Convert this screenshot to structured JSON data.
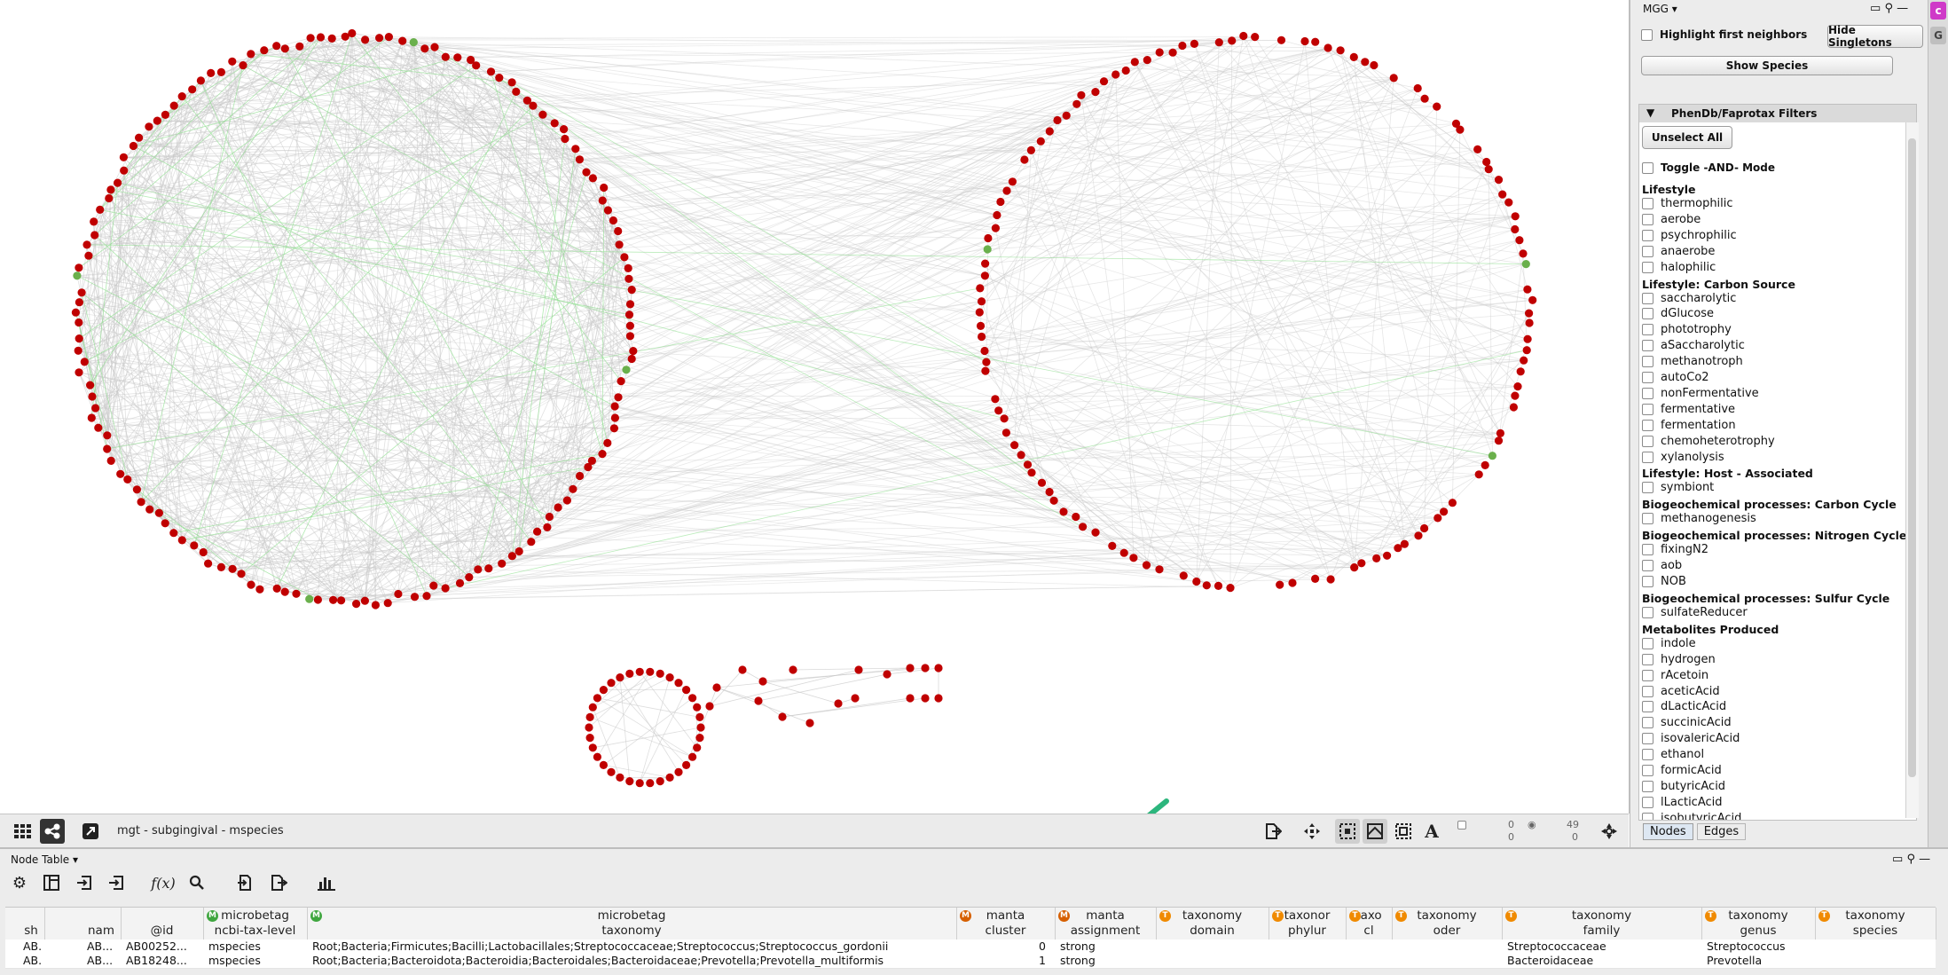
{
  "network": {
    "title": "mgt - subgingival - mspecies",
    "selection_counts": {
      "nodes_selected": "0",
      "edges_selected": "0",
      "nodes_visible": "49",
      "edges_visible": "0"
    }
  },
  "side_panel": {
    "dropdown_label": "MGG",
    "highlight_label": "Highlight first neighbors",
    "hide_singletons_label": "Hide Singletons",
    "show_species_label": "Show Species",
    "filters_title": "PhenDb/Faprotax Filters",
    "unselect_all_label": "Unselect All",
    "toggle_and_label": "Toggle -AND- Mode",
    "groups": [
      {
        "title": "Lifestyle",
        "items": [
          "thermophilic",
          "aerobe",
          "psychrophilic",
          "anaerobe",
          "halophilic"
        ]
      },
      {
        "title": "Lifestyle: Carbon Source",
        "items": [
          "saccharolytic",
          "dGlucose",
          "phototrophy",
          "aSaccharolytic",
          "methanotroph",
          "autoCo2",
          "nonFermentative",
          "fermentative",
          "fermentation",
          "chemoheterotrophy",
          "xylanolysis"
        ]
      },
      {
        "title": "Lifestyle: Host - Associated",
        "items": [
          "symbiont"
        ]
      },
      {
        "title": "Biogeochemical processes: Carbon Cycle",
        "items": [
          "methanogenesis"
        ]
      },
      {
        "title": "Biogeochemical processes: Nitrogen Cycle",
        "items": [
          "fixingN2",
          "aob",
          "NOB"
        ]
      },
      {
        "title": "Biogeochemical processes: Sulfur Cycle",
        "items": [
          "sulfateReducer"
        ]
      },
      {
        "title": "Metabolites Produced",
        "items": [
          "indole",
          "hydrogen",
          "rAcetoin",
          "aceticAcid",
          "dLacticAcid",
          "succinicAcid",
          "isovalericAcid",
          "ethanol",
          "formicAcid",
          "butyricAcid",
          "lLacticAcid",
          "isobutyricAcid"
        ]
      }
    ],
    "tabs": [
      "Nodes",
      "Edges"
    ],
    "strip_chips": [
      "c",
      "G"
    ]
  },
  "table_panel": {
    "title": "Node Table",
    "columns": [
      {
        "line1": "",
        "line2": "sh"
      },
      {
        "line1": "",
        "line2": "nam"
      },
      {
        "line1": "",
        "line2": "@id"
      },
      {
        "line1": "microbetag",
        "line2": "ncbi-tax-level",
        "badge": "M"
      },
      {
        "line1": "microbetag",
        "line2": "taxonomy",
        "badge": "M"
      },
      {
        "line1": "manta",
        "line2": "cluster",
        "badge": "M"
      },
      {
        "line1": "manta",
        "line2": "assignment",
        "badge": "M"
      },
      {
        "line1": "taxonomy",
        "line2": "domain",
        "badge": "T"
      },
      {
        "line1": "taxonor",
        "line2": "phylur",
        "badge": "T"
      },
      {
        "line1": "taxo",
        "line2": "cl",
        "badge": "T"
      },
      {
        "line1": "taxonomy",
        "line2": "oder",
        "badge": "T"
      },
      {
        "line1": "taxonomy",
        "line2": "family",
        "badge": "T"
      },
      {
        "line1": "taxonomy",
        "line2": "genus",
        "badge": "T"
      },
      {
        "line1": "taxonomy",
        "line2": "species",
        "badge": "T"
      }
    ],
    "rows": [
      {
        "sh": "AB...",
        "nam": "AB...",
        "id": "AB00252...",
        "level": "mspecies",
        "taxonomy": "Root;Bacteria;Firmicutes;Bacilli;Lactobacillales;Streptococcaceae;Streptococcus;Streptococcus_gordonii",
        "cluster": "0",
        "assignment": "strong",
        "family": "Streptococcaceae",
        "genus": "Streptococcus"
      },
      {
        "sh": "AB...",
        "nam": "AB...",
        "id": "AB18248...",
        "level": "mspecies",
        "taxonomy": "Root;Bacteria;Bacteroidota;Bacteroidia;Bacteroidales;Bacteroidaceae;Prevotella;Prevotella_multiformis",
        "cluster": "1",
        "assignment": "strong",
        "family": "Bacteroidaceae",
        "genus": "Prevotella"
      }
    ]
  },
  "colors": {
    "node": "#c00000",
    "node_highlight": "#6ab04c",
    "edge": "#c8c8c8",
    "edge_positive": "#8ee08e",
    "arrow": "#2cb67d"
  }
}
